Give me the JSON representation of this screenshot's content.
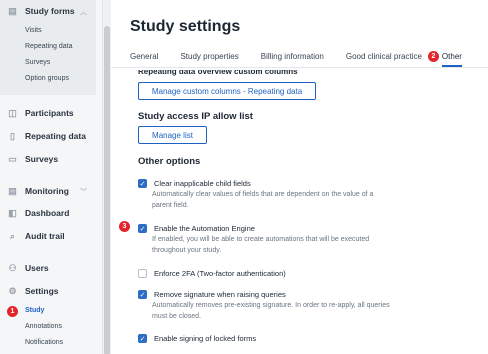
{
  "sidebar": {
    "group": {
      "label": "Study forms",
      "icon": "form-icon",
      "items": [
        "Visits",
        "Repeating data",
        "Surveys",
        "Option groups"
      ]
    },
    "items": [
      {
        "label": "Participants",
        "icon": "participants-icon"
      },
      {
        "label": "Repeating data",
        "icon": "repeating-data-icon"
      },
      {
        "label": "Surveys",
        "icon": "surveys-icon"
      },
      {
        "label": "Monitoring",
        "icon": "monitoring-icon"
      },
      {
        "label": "Dashboard",
        "icon": "dashboard-icon"
      },
      {
        "label": "Audit trail",
        "icon": "audit-trail-icon"
      },
      {
        "label": "Users",
        "icon": "users-icon"
      },
      {
        "label": "Settings",
        "icon": "settings-icon"
      }
    ],
    "settings_items": [
      "Study",
      "Annotations",
      "Notifications"
    ],
    "badge_1": "1"
  },
  "main": {
    "title": "Study settings",
    "tabs": [
      "General",
      "Study properties",
      "Billing information",
      "Good clinical practice",
      "Other"
    ],
    "badge_2": "2",
    "cut_heading": "Repeating data overview custom columns",
    "manage_columns_label": "Manage custom columns - Repeating data",
    "ip_allow_heading": "Study access IP allow list",
    "manage_list_label": "Manage list",
    "other_options_heading": "Other options",
    "badge_3": "3",
    "options": [
      {
        "label": "Clear inapplicable child fields",
        "checked": true,
        "desc": "Automatically clear values of fields that are dependent on the value of a parent field."
      },
      {
        "label": "Enable the Automation Engine",
        "checked": true,
        "desc": "If enabled, you will be able to create automations that will be executed throughout your study."
      },
      {
        "label": "Enforce 2FA (Two-factor authentication)",
        "checked": false,
        "desc": ""
      },
      {
        "label": "Remove signature when raising queries",
        "checked": true,
        "desc": "Automatically removes pre-existing signature. In order to re-apply, all queries must be closed."
      },
      {
        "label": "Enable signing of locked forms",
        "checked": true,
        "desc": ""
      }
    ]
  },
  "colors": {
    "accent": "#1f62c4",
    "badge": "#e3242b",
    "sidebar_bg": "#f4f6f8"
  }
}
